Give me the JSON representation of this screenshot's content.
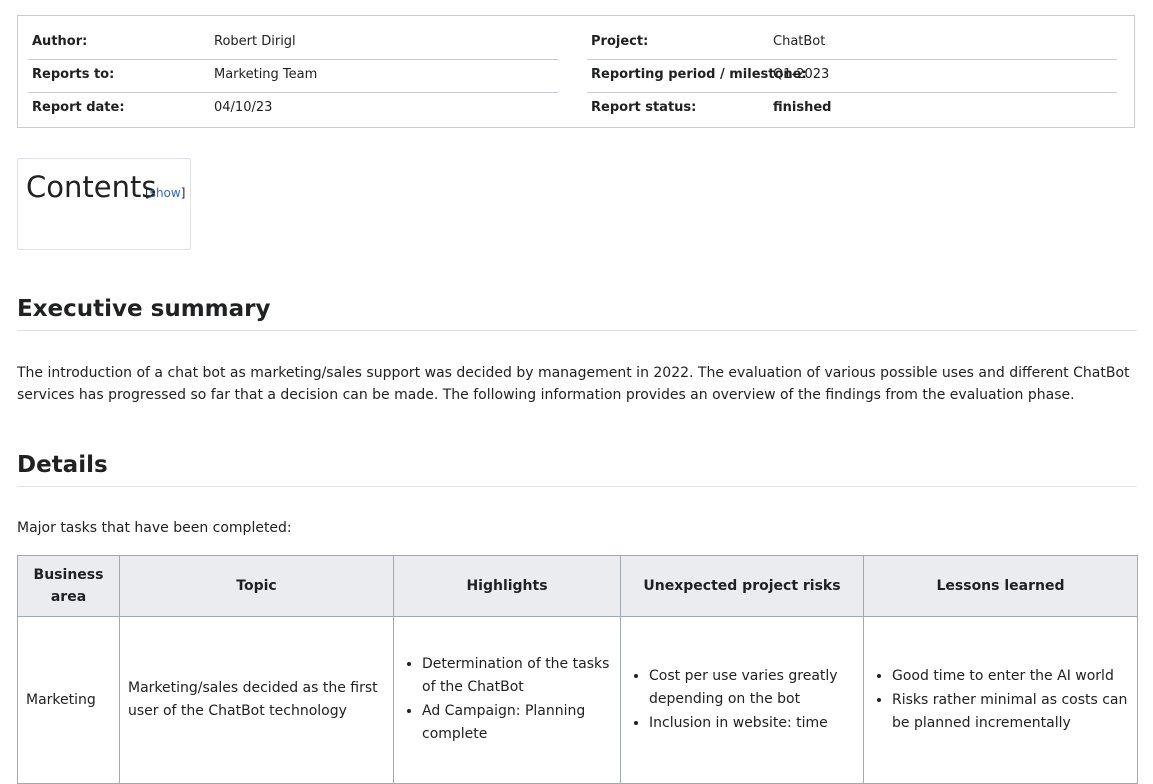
{
  "report_info": {
    "left": [
      {
        "label": "Author:",
        "value": "Robert Dirigl"
      },
      {
        "label": "Reports to:",
        "value": "Marketing Team"
      },
      {
        "label": "Report date:",
        "value": "04/10/23"
      }
    ],
    "right": [
      {
        "label": "Project:",
        "value": "ChatBot"
      },
      {
        "label": "Reporting period / milestone:",
        "value": "Q1-2023"
      },
      {
        "label": "Report status:",
        "value": "finished"
      }
    ]
  },
  "toc": {
    "title": "Contents",
    "bracket_open": "[",
    "toggle_label": "show",
    "bracket_close": "]"
  },
  "sections": {
    "executive_summary": {
      "heading": "Executive summary",
      "text": "The introduction of a chat bot as marketing/sales support was decided by management in 2022. The evaluation of various possible uses and different ChatBot services has progressed so far that a decision can be made. The following information provides an overview of the findings from the evaluation phase."
    },
    "details": {
      "heading": "Details",
      "intro": "Major tasks that have been completed:"
    }
  },
  "table": {
    "headers": [
      "Business area",
      "Topic",
      "Highlights",
      "Unexpected project risks",
      "Lessons learned"
    ],
    "rows": [
      {
        "business_area": "Marketing",
        "topic": "Marketing/sales decided as the first user of the ChatBot technology",
        "highlights": [
          "Determination of the tasks of the ChatBot",
          "Ad Campaign: Planning complete"
        ],
        "risks": [
          "Cost per use varies greatly depending on the bot",
          "Inclusion in website: time"
        ],
        "lessons": [
          "Good time to enter the AI world",
          "Risks rather minimal as costs can be planned incrementally"
        ]
      }
    ]
  }
}
